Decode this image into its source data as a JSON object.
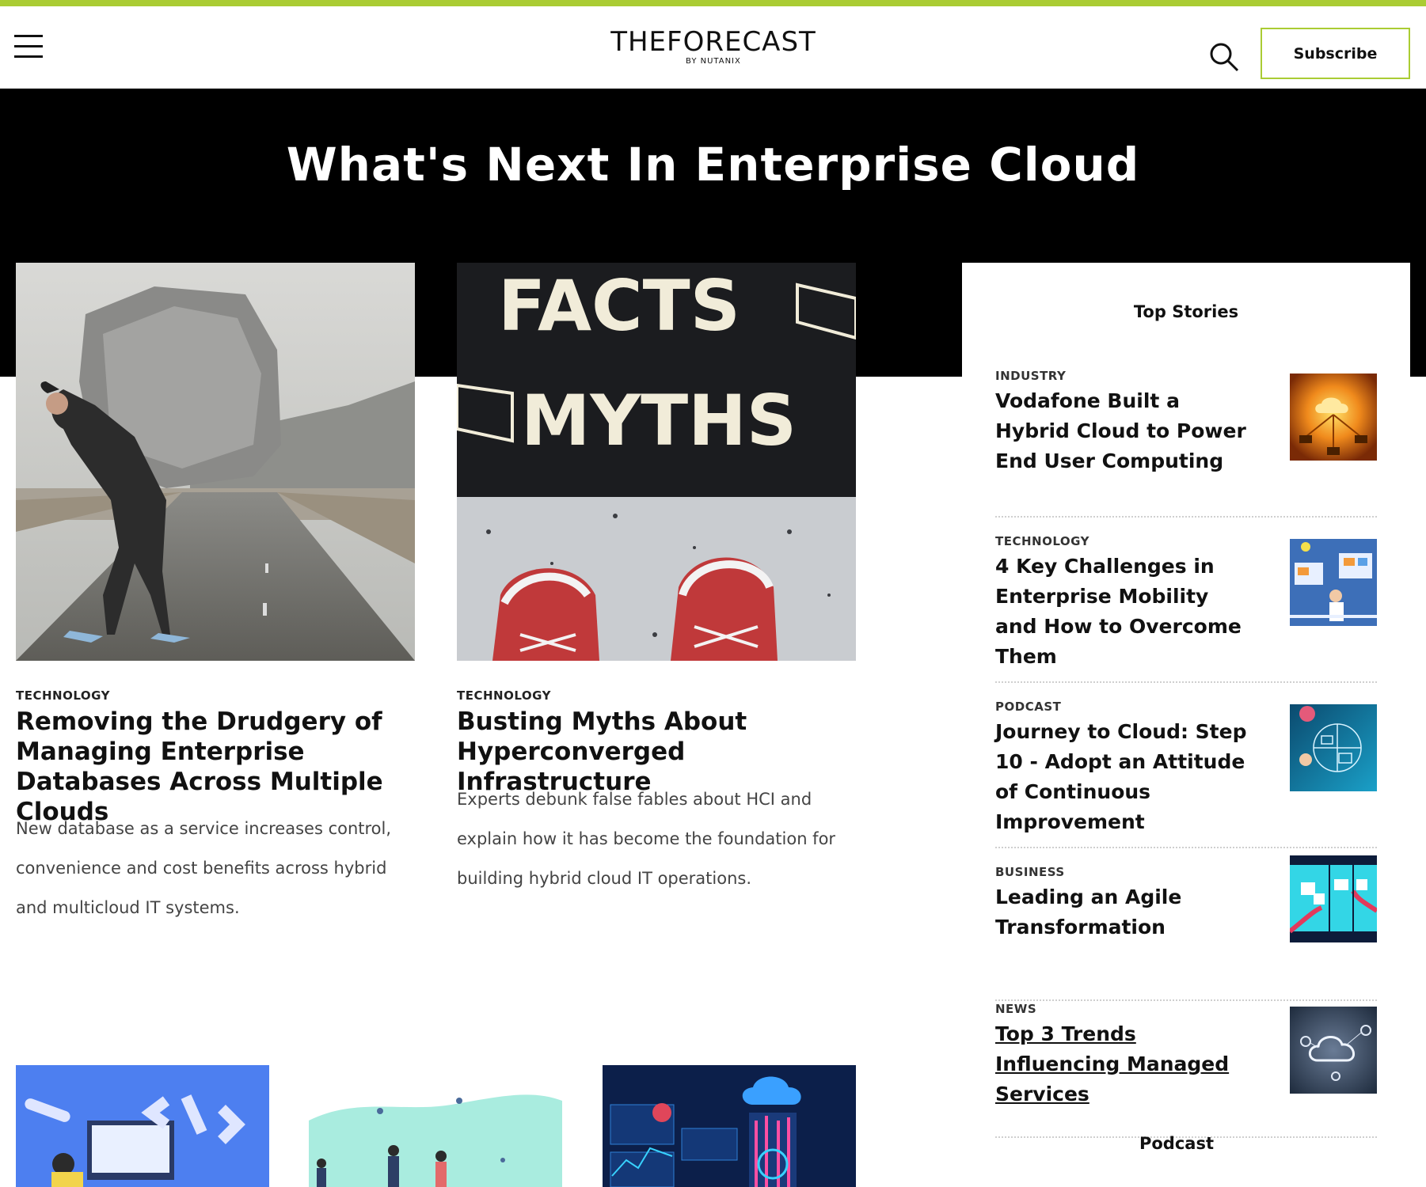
{
  "header": {
    "logo_main": "THEFORECAST",
    "logo_sub": "BY NUTANIX",
    "subscribe_label": "Subscribe"
  },
  "hero": {
    "title": "What's Next In Enterprise Cloud"
  },
  "featured": [
    {
      "category": "TECHNOLOGY",
      "title": "Removing the Drudgery of Managing Enterprise Databases Across Multiple Clouds",
      "description": "New database as a service increases control, convenience and cost benefits across hybrid and multicloud IT systems."
    },
    {
      "category": "TECHNOLOGY",
      "title": "Busting Myths About Hyperconverged Infrastructure",
      "description": "Experts debunk false fables about HCI and explain how it has become the foundation for building hybrid cloud IT operations.",
      "image_text_top": "FACTS",
      "image_text_bottom": "MYTHS"
    }
  ],
  "sidebar": {
    "heading": "Top Stories",
    "stories": [
      {
        "category": "INDUSTRY",
        "title": "Vodafone Built a Hybrid Cloud to Power End User Computing"
      },
      {
        "category": "TECHNOLOGY",
        "title": "4 Key Challenges in Enterprise Mobility and How to Overcome Them"
      },
      {
        "category": "PODCAST",
        "title": "Journey to Cloud: Step 10 - Adopt an Attitude of Continuous Improvement"
      },
      {
        "category": "BUSINESS",
        "title": "Leading an Agile Transformation"
      },
      {
        "category": "NEWS",
        "title": "Top 3 Trends Influencing Managed Services"
      }
    ],
    "podcast_heading": "Podcast"
  },
  "colors": {
    "accent": "#aacc33",
    "hero_bg": "#000000"
  }
}
